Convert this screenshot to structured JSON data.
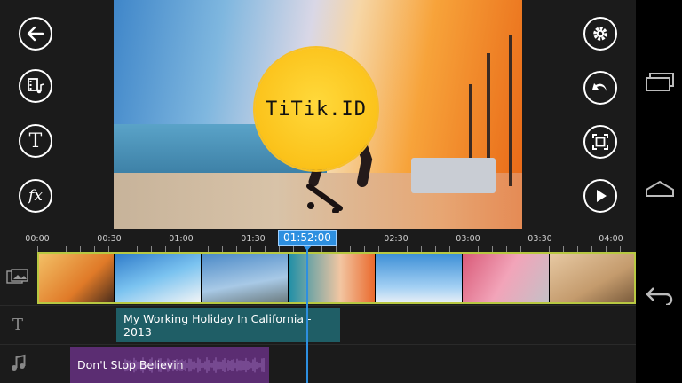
{
  "app": {
    "left_toolbar": [
      {
        "name": "back-arrow-icon"
      },
      {
        "name": "media-browser-icon"
      },
      {
        "name": "text-tool-icon",
        "glyph": "T"
      },
      {
        "name": "effects-icon",
        "glyph": "fx"
      }
    ],
    "right_toolbar": [
      {
        "name": "settings-gear-icon"
      },
      {
        "name": "undo-icon"
      },
      {
        "name": "fullscreen-icon"
      },
      {
        "name": "play-icon"
      }
    ],
    "preview": {
      "watermark": "TiTik.ID"
    },
    "timeline": {
      "ruler_labels": [
        "00:00",
        "00:30",
        "01:00",
        "01:30",
        "02:30",
        "03:00",
        "03:30",
        "04:00"
      ],
      "playhead_time": "01:52:00",
      "text_track_icon": "T",
      "text_clip_label": "My Working Holiday In California - 2013",
      "audio_clip_label": "Don't Stop Believin",
      "accent_color": "#2d8fe0",
      "video_track_border_color": "#b8c842"
    }
  },
  "system_nav": [
    {
      "name": "recent-apps-icon"
    },
    {
      "name": "home-icon"
    },
    {
      "name": "back-icon"
    }
  ]
}
